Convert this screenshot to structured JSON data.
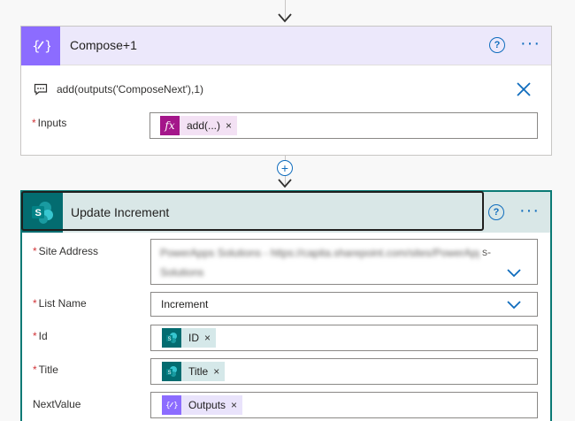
{
  "compose_card": {
    "title": "Compose+1",
    "help_label": "?",
    "more_label": "···",
    "comment": "add(outputs('ComposeNext'),1)",
    "inputs_label": "Inputs",
    "inputs_token": "add(...)",
    "token_remove": "×",
    "accent_color": "#8c6cff"
  },
  "connector": {
    "plus_label": "+"
  },
  "update_card": {
    "title": "Update Increment",
    "help_label": "?",
    "more_label": "···",
    "accent_color": "#036c70",
    "fields": {
      "site_address": {
        "label": "Site Address",
        "line1": "PowerApps Solutions - https://capita.sharepoint.com/sites/PowerApps",
        "line1_tail": "s-",
        "line2": "Solutions"
      },
      "list_name": {
        "label": "List Name",
        "value": "Increment"
      },
      "id": {
        "label": "Id",
        "token": "ID"
      },
      "title": {
        "label": "Title",
        "token": "Title"
      },
      "next_value": {
        "label": "NextValue",
        "token": "Outputs"
      }
    },
    "required_mark": "*",
    "token_remove": "×"
  }
}
